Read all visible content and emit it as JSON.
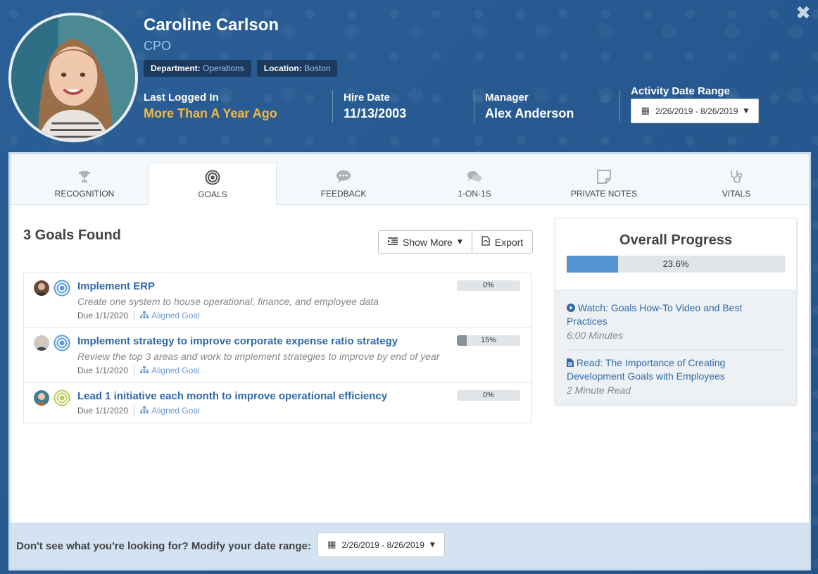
{
  "header": {
    "name": "Caroline Carlson",
    "role": "CPO",
    "department_label": "Department:",
    "department_value": "Operations",
    "location_label": "Location:",
    "location_value": "Boston",
    "last_logged_in_label": "Last Logged In",
    "last_logged_in_value": "More Than A Year Ago",
    "hire_date_label": "Hire Date",
    "hire_date_value": "11/13/2003",
    "manager_label": "Manager",
    "manager_value": "Alex Anderson",
    "activity_range_label": "Activity Date Range",
    "activity_range_value": "2/26/2019 - 8/26/2019"
  },
  "tabs": [
    {
      "label": "RECOGNITION",
      "icon": "trophy-icon"
    },
    {
      "label": "GOALS",
      "icon": "target-icon"
    },
    {
      "label": "FEEDBACK",
      "icon": "comment-icon"
    },
    {
      "label": "1-ON-1S",
      "icon": "comments-icon"
    },
    {
      "label": "PRIVATE NOTES",
      "icon": "note-icon"
    },
    {
      "label": "VITALS",
      "icon": "stethoscope-icon"
    }
  ],
  "goals": {
    "count_title": "3 Goals Found",
    "show_more_label": "Show More",
    "export_label": "Export",
    "items": [
      {
        "title": "Implement ERP",
        "description": "Create one system to house operational, finance, and employee data",
        "due": "Due 1/1/2020",
        "aligned": "Aligned Goal",
        "progress": 0,
        "progress_label": "0%",
        "target_color": "#5a9bd8"
      },
      {
        "title": "Implement strategy to improve corporate expense ratio strategy",
        "description": "Review the top 3 areas and work to implement strategies to improve by end of year",
        "due": "Due 1/1/2020",
        "aligned": "Aligned Goal",
        "progress": 15,
        "progress_label": "15%",
        "target_color": "#5a9bd8"
      },
      {
        "title": "Lead 1 initiative each month to improve operational efficiency",
        "description": "",
        "due": "Due 1/1/2020",
        "aligned": "Aligned Goal",
        "progress": 0,
        "progress_label": "0%",
        "target_color": "#b6cf5a"
      }
    ]
  },
  "overall": {
    "title": "Overall Progress",
    "progress": 23.6,
    "progress_label": "23.6%",
    "resources": [
      {
        "icon": "play-circle-icon",
        "link": "Watch: Goals How-To Video and Best Practices",
        "sub": "6:00 Minutes"
      },
      {
        "icon": "document-icon",
        "link": "Read: The Importance of Creating Development Goals with Employees",
        "sub": "2 Minute Read"
      }
    ]
  },
  "footer": {
    "text": "Don't see what you're looking for? Modify your date range:",
    "range_value": "2/26/2019 - 8/26/2019"
  },
  "colors": {
    "accent": "#2e6aa8",
    "warn": "#f5b642",
    "header_bg": "#285a8f",
    "progress_fill": "#5592d2"
  }
}
